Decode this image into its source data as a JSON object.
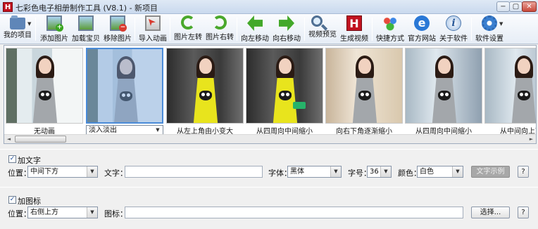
{
  "window": {
    "app_icon_letter": "H",
    "title": "七彩色电子相册制作工具 (V8.1) - 新项目",
    "controls": {
      "minimize": "−",
      "maximize": "▢",
      "close": "✕"
    }
  },
  "toolbar": {
    "items": [
      {
        "label": "我的项目",
        "icon": "folder-icon"
      },
      {
        "label": "添加图片",
        "icon": "add-image-icon"
      },
      {
        "label": "加载宝贝",
        "icon": "load-image-icon"
      },
      {
        "label": "移除图片",
        "icon": "remove-image-icon"
      },
      {
        "label": "导入动画",
        "icon": "import-animation-icon"
      },
      {
        "label": "图片左转",
        "icon": "rotate-left-icon"
      },
      {
        "label": "图片右转",
        "icon": "rotate-right-icon"
      },
      {
        "label": "向左移动",
        "icon": "arrow-left-icon"
      },
      {
        "label": "向右移动",
        "icon": "arrow-right-icon"
      },
      {
        "label": "视频预览",
        "icon": "magnifier-icon"
      },
      {
        "label": "生成视频",
        "icon": "generate-video-icon"
      },
      {
        "label": "快捷方式",
        "icon": "cubes-icon"
      },
      {
        "label": "官方网站",
        "icon": "ie-icon"
      },
      {
        "label": "关于软件",
        "icon": "info-icon"
      },
      {
        "label": "软件设置",
        "icon": "gear-icon"
      }
    ],
    "icon_glyphs": {
      "add": "+",
      "remove": "−",
      "h": "H",
      "ie": "e",
      "info": "i",
      "dropdown": "▼"
    }
  },
  "filmstrip": {
    "thumbnails": [
      {
        "effect": "无动画"
      },
      {
        "effect": "淡入淡出",
        "selected": true
      },
      {
        "effect": "从左上角由小变大"
      },
      {
        "effect": "从四周向中间缩小"
      },
      {
        "effect": "向右下角逐渐缩小"
      },
      {
        "effect": "从四周向中间缩小"
      },
      {
        "effect": "从中间向上下"
      }
    ],
    "scroll": {
      "left_arrow": "◄",
      "right_arrow": "►"
    }
  },
  "text_options": {
    "enable_label": "加文字",
    "enabled": true,
    "check_mark": "✓",
    "position_label": "位置：",
    "position_value": "中间下方",
    "text_label": "文字：",
    "text_value": "",
    "font_label": "字体：",
    "font_value": "黑体",
    "size_label": "字号：",
    "size_value": "36",
    "color_label": "颜色：",
    "color_value": "白色",
    "sample_button": "文字示例",
    "help_button": "?"
  },
  "icon_options": {
    "enable_label": "加图标",
    "enabled": true,
    "check_mark": "✓",
    "position_label": "位置：",
    "position_value": "右侧上方",
    "icon_label": "图标：",
    "icon_value": "",
    "browse_button": "选择...",
    "help_button": "?"
  },
  "colors": {
    "accent": "#c1121f",
    "selection": "#4a8bd8",
    "dress_yellow": "#e8e41d",
    "dress_grey": "#a3a7ab"
  }
}
